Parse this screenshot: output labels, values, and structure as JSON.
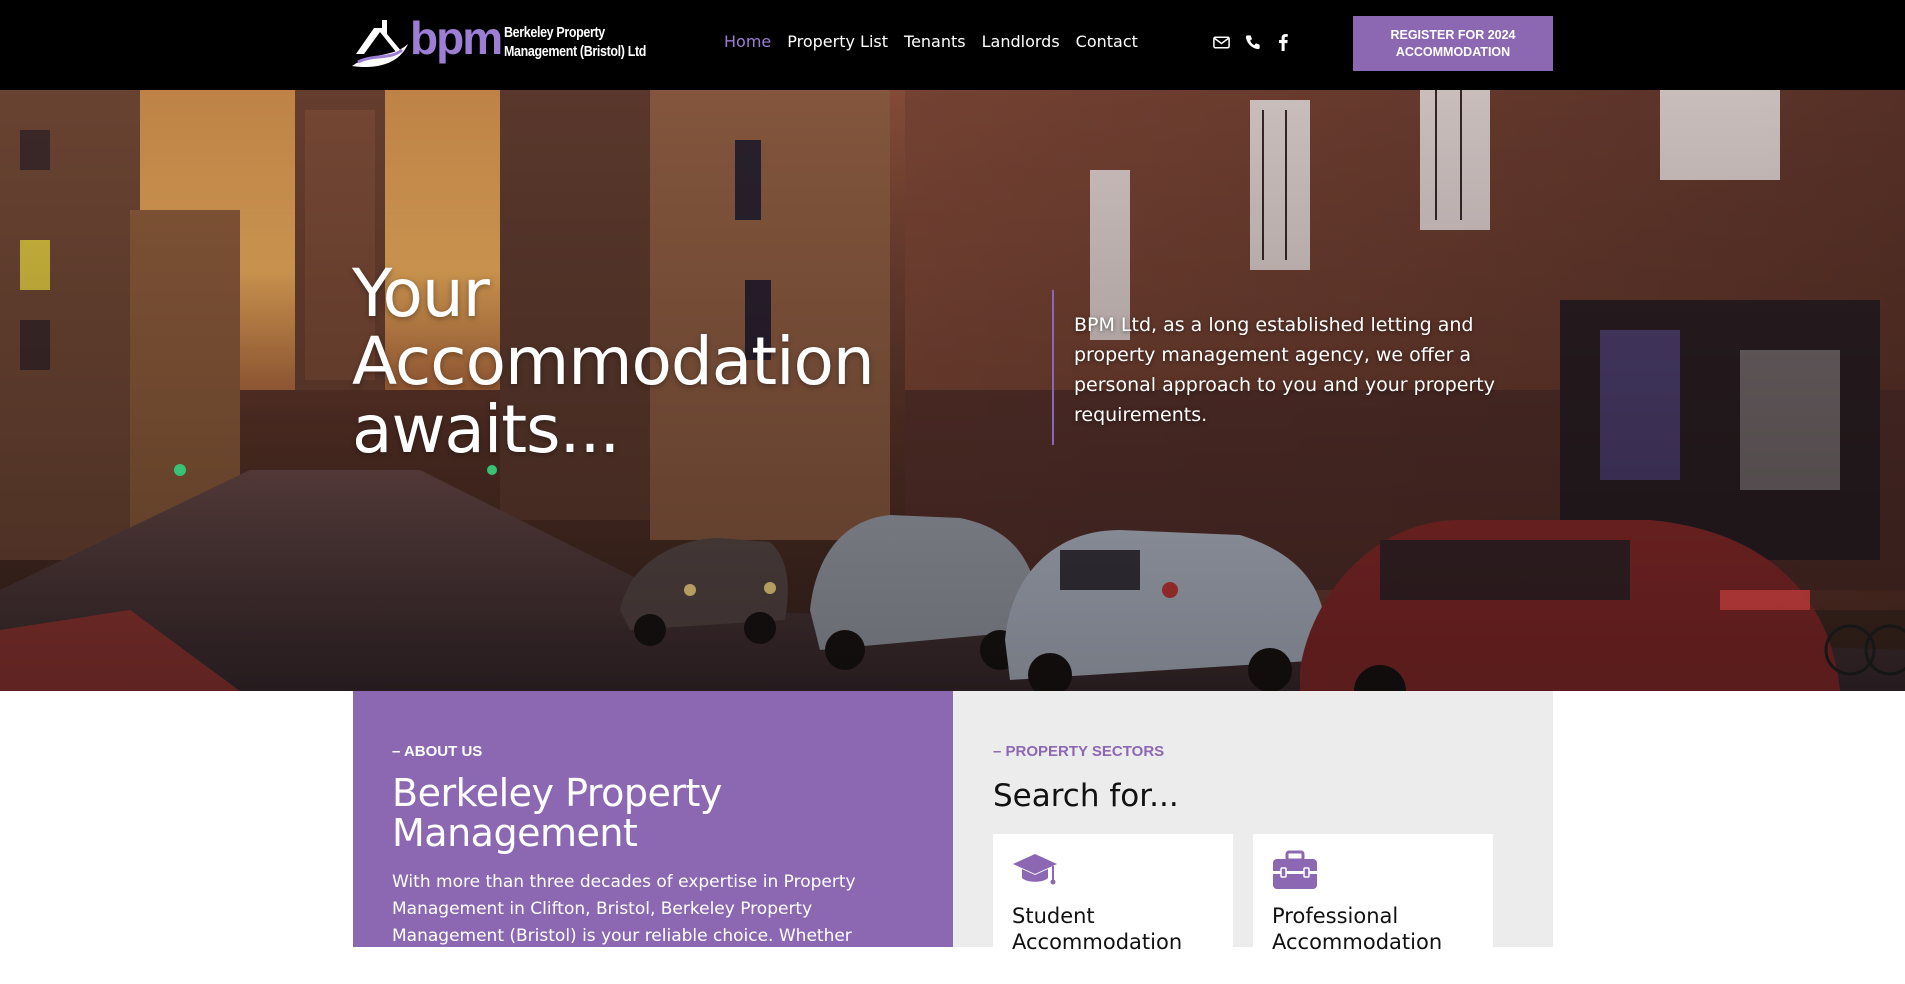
{
  "header": {
    "logo": {
      "mark": "bpm",
      "line1": "Berkeley Property",
      "line2": "Management (Bristol) Ltd"
    },
    "nav": [
      {
        "label": "Home",
        "active": true
      },
      {
        "label": "Property List",
        "active": false
      },
      {
        "label": "Tenants",
        "active": false
      },
      {
        "label": "Landlords",
        "active": false
      },
      {
        "label": "Contact",
        "active": false
      }
    ],
    "social_icons": [
      "envelope-icon",
      "phone-icon",
      "facebook-icon"
    ],
    "register_button": {
      "line1": "REGISTER FOR 2024",
      "line2": "ACCOMMODATION"
    }
  },
  "hero": {
    "title_lines": [
      "Your",
      "Accommodation",
      "awaits..."
    ],
    "description": "BPM Ltd, as a long established letting and property management agency, we offer a personal approach to you and your property requirements."
  },
  "about": {
    "eyebrow": "– ABOUT US",
    "heading": "Berkeley Property Management",
    "body": "With more than three decades of expertise in Property Management in Clifton, Bristol, Berkeley Property Management (Bristol) is your reliable choice. Whether"
  },
  "sectors": {
    "eyebrow": "– PROPERTY SECTORS",
    "heading": "Search for...",
    "cards": [
      {
        "title": "Student Accommodation",
        "icon": "graduation-cap-icon"
      },
      {
        "title": "Professional Accommodation",
        "icon": "briefcase-icon"
      }
    ]
  },
  "colors": {
    "brand_purple": "#8c68b3",
    "header_bg": "#000000",
    "nav_active": "#9c7fd4",
    "sectors_bg": "#ececec"
  }
}
